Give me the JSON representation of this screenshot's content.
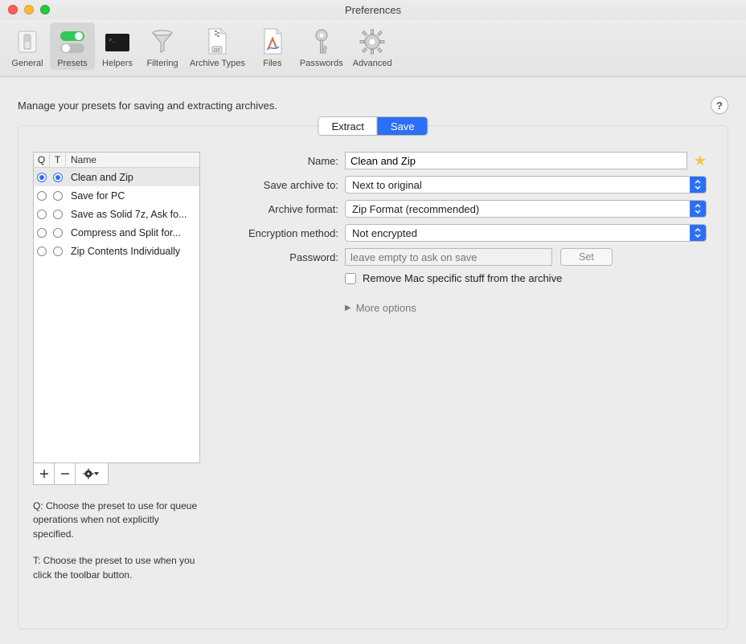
{
  "window": {
    "title": "Preferences"
  },
  "toolbar": {
    "items": [
      {
        "id": "general",
        "label": "General"
      },
      {
        "id": "presets",
        "label": "Presets"
      },
      {
        "id": "helpers",
        "label": "Helpers"
      },
      {
        "id": "filtering",
        "label": "Filtering"
      },
      {
        "id": "archive-types",
        "label": "Archive Types"
      },
      {
        "id": "files",
        "label": "Files"
      },
      {
        "id": "passwords",
        "label": "Passwords"
      },
      {
        "id": "advanced",
        "label": "Advanced"
      }
    ],
    "selected": "presets"
  },
  "subtitle": "Manage your presets for saving and extracting archives.",
  "help_button": "?",
  "segmented": {
    "extract_label": "Extract",
    "save_label": "Save",
    "active": "save"
  },
  "preset_list": {
    "headers": {
      "q": "Q",
      "t": "T",
      "name": "Name"
    },
    "rows": [
      {
        "q": true,
        "t": true,
        "name": "Clean and Zip",
        "selected": true
      },
      {
        "q": false,
        "t": false,
        "name": "Save for PC",
        "selected": false
      },
      {
        "q": false,
        "t": false,
        "name": "Save as Solid 7z, Ask fo...",
        "selected": false
      },
      {
        "q": false,
        "t": false,
        "name": "Compress and Split for...",
        "selected": false
      },
      {
        "q": false,
        "t": false,
        "name": "Zip Contents Individually",
        "selected": false
      }
    ],
    "buttons": {
      "add": "+",
      "remove": "−",
      "gear": "✻▾"
    },
    "help_q": "Q: Choose the preset to use for queue operations when not explicitly specified.",
    "help_t": "T: Choose the preset to use when you click the toolbar button."
  },
  "form": {
    "name_label": "Name:",
    "name_value": "Clean and Zip",
    "save_to_label": "Save archive to:",
    "save_to_value": "Next to original",
    "format_label": "Archive format:",
    "format_value": "Zip Format (recommended)",
    "encryption_label": "Encryption method:",
    "encryption_value": "Not encrypted",
    "password_label": "Password:",
    "password_placeholder": "leave empty to ask on save",
    "set_button": "Set",
    "remove_mac_label": "Remove Mac specific stuff from the archive",
    "more_options": "More options"
  }
}
